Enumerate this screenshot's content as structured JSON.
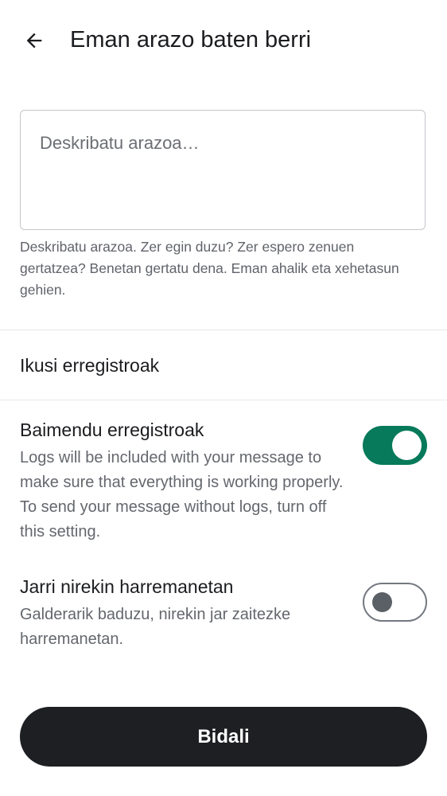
{
  "header": {
    "back_icon": "arrow-left-icon",
    "title": "Eman arazo baten berri"
  },
  "description": {
    "value": "",
    "placeholder": "Deskribatu arazoa…",
    "helper": "Deskribatu arazoa. Zer egin duzu? Zer espero zenuen gertatzea? Benetan gertatu dena. Eman ahalik eta xehetasun gehien."
  },
  "view_logs": {
    "label": "Ikusi erregistroak"
  },
  "settings": [
    {
      "title": "Baimendu erregistroak",
      "description": "Logs will be included with your message to make sure that everything is working properly. To send your message without logs, turn off this setting.",
      "enabled": true
    },
    {
      "title": "Jarri nirekin harremanetan",
      "description": "Galderarik baduzu, nirekin jar zaitezke harremanetan.",
      "enabled": false
    }
  ],
  "send_button": {
    "label": "Bidali"
  },
  "colors": {
    "toggle_on": "#067a5a",
    "button_bg": "#1e1f23",
    "text_primary": "#1b1c1f",
    "text_secondary": "#64676d"
  }
}
